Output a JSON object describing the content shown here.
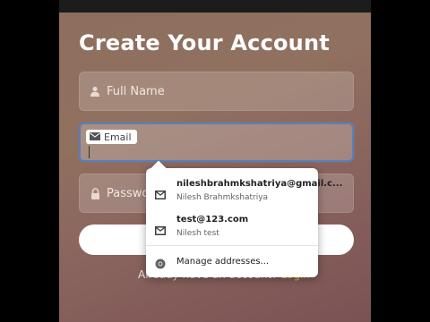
{
  "form": {
    "title": "Create Your Account",
    "fields": {
      "full_name_placeholder": "Full Name",
      "email_label": "Email",
      "password_placeholder": "Password"
    },
    "footer": {
      "text": "Already have an account?",
      "link": "Login"
    }
  },
  "autofill": {
    "suggestions": [
      {
        "primary": "nileshbrahmkshatriya@gmail.c...",
        "secondary": "Nilesh Brahmkshatriya",
        "icon": "email-icon"
      },
      {
        "primary": "test@123.com",
        "secondary": "Nilesh test",
        "icon": "email-icon"
      }
    ],
    "manage_label": "Manage addresses...",
    "manage_icon": "chrome-icon"
  },
  "colors": {
    "focus_border": "#5c7fb8",
    "link": "#f5c23a"
  }
}
